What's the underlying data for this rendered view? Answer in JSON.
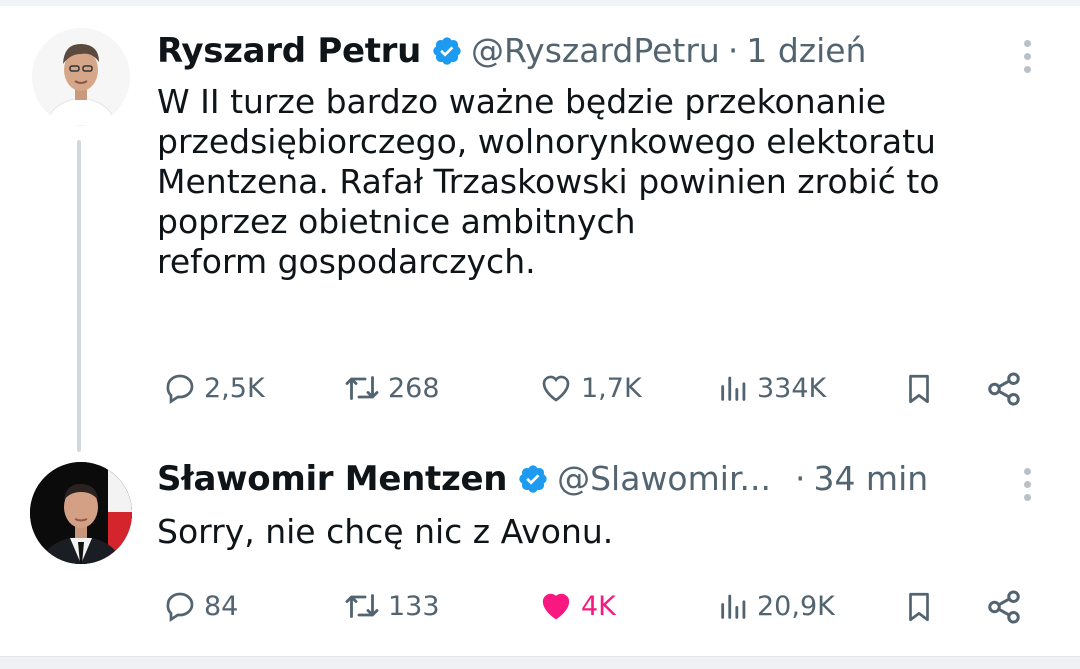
{
  "tweets": [
    {
      "name": "Ryszard Petru",
      "handle": "@RyszardPetru",
      "separator": "·",
      "time": "1 dzień",
      "text_lines": [
        "W II turze bardzo ważne będzie przekonanie",
        "przedsiębiorczego, wolnorynkowego elektoratu",
        "Mentzena. Rafał Trzaskowski powinien zrobić to",
        "poprzez obietnice ambitnych",
        "reform gospodarczych."
      ],
      "replies": "2,5K",
      "reposts": "268",
      "likes": "1,7K",
      "liked": false,
      "views": "334K"
    },
    {
      "name": "Sławomir Mentzen",
      "handle": "@Slawomir...",
      "separator": "·",
      "time": "34 min",
      "text_lines": [
        "Sorry, nie chcę nic z Avonu."
      ],
      "replies": "84",
      "reposts": "133",
      "likes": "4K",
      "liked": true,
      "views": "20,9K"
    }
  ],
  "colors": {
    "verified": "#1d9bf0",
    "muted": "#536471",
    "like_active": "#f91880",
    "thread_line": "#cfd9de"
  },
  "icons": [
    "verified-badge-icon",
    "more-icon",
    "reply-icon",
    "repost-icon",
    "like-icon",
    "views-icon",
    "bookmark-icon",
    "share-icon"
  ]
}
